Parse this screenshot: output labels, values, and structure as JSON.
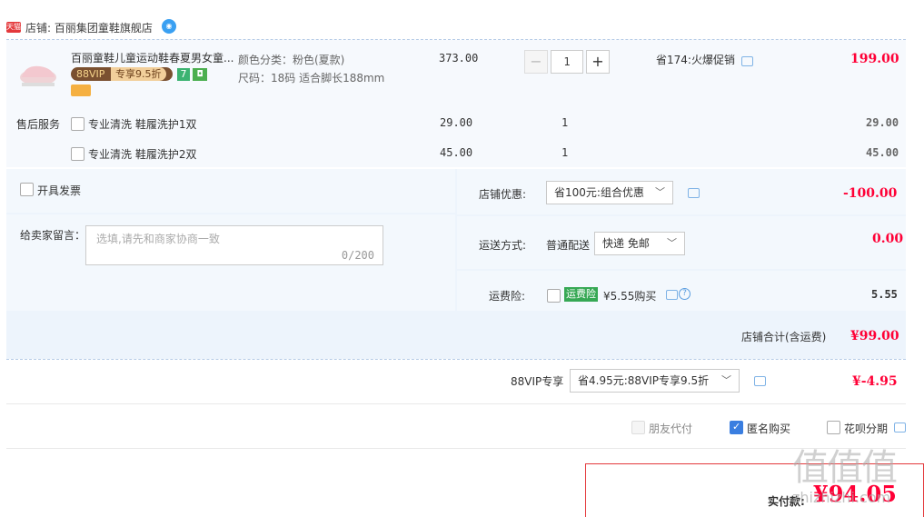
{
  "shop": {
    "label": "店铺:",
    "name": "百丽集团童鞋旗舰店",
    "tmall_logo": "天猫",
    "wangwang_icon": "wangwang-icon"
  },
  "item": {
    "title": "百丽童鞋儿童运动鞋春夏男女童...",
    "vip_badge": "88VIP",
    "vip_text": "专享9.5折",
    "badge_7": "7",
    "attr_color": "颜色分类：粉色(夏款)",
    "attr_size": "尺码：18码 适合脚长188mm",
    "unit_price": "373.00",
    "quantity": "1",
    "promo": "省174:火爆促销",
    "subtotal": "199.00"
  },
  "services": {
    "label": "售后服务",
    "items": [
      {
        "name": "专业清洗 鞋履洗护1双",
        "price": "29.00",
        "qty": "1",
        "total": "29.00"
      },
      {
        "name": "专业清洗 鞋履洗护2双",
        "price": "45.00",
        "qty": "1",
        "total": "45.00"
      }
    ]
  },
  "invoice": {
    "label": "开具发票"
  },
  "message": {
    "label": "给卖家留言：",
    "placeholder": "选填,请先和商家协商一致",
    "counter": "0/200"
  },
  "discount": {
    "label": "店铺优惠:",
    "selected": "省100元:组合优惠",
    "amount": "-100.00"
  },
  "shipping": {
    "label": "运送方式:",
    "type": "普通配送",
    "selected": "快递 免邮",
    "amount": "0.00"
  },
  "insurance": {
    "label": "运费险:",
    "tag": "运费险",
    "text": "¥5.55购买",
    "amount": "5.55"
  },
  "shop_total": {
    "label": "店铺合计(含运费)",
    "amount": "¥99.00"
  },
  "vip88": {
    "label": "88VIP专享",
    "selected": "省4.95元:88VIP专享9.5折",
    "amount": "¥-4.95"
  },
  "options": {
    "friend_pay": "朋友代付",
    "anonymous": "匿名购买",
    "huabei": "花呗分期"
  },
  "pay": {
    "label": "实付款:",
    "amount": "¥94.05"
  },
  "watermark": {
    "text": "值值值",
    "url": "zhizhizhi.com"
  }
}
